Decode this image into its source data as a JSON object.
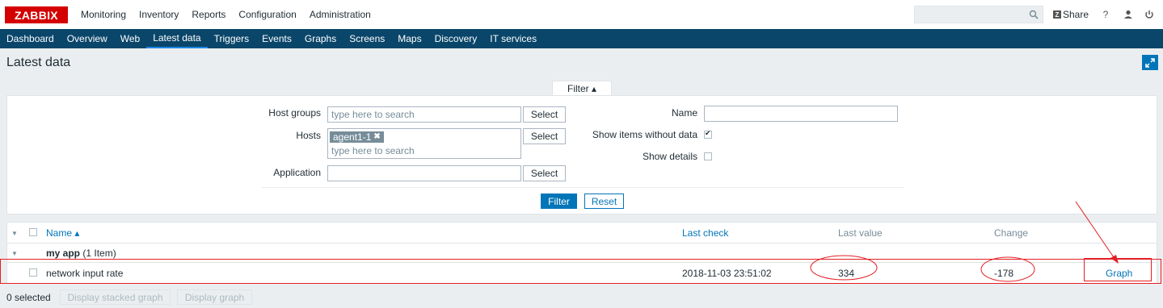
{
  "brand": {
    "logo": "ZABBIX"
  },
  "topmenu": [
    "Monitoring",
    "Inventory",
    "Reports",
    "Configuration",
    "Administration"
  ],
  "header_right": {
    "share": "Share",
    "help": "?",
    "search_placeholder": ""
  },
  "submenu": [
    "Dashboard",
    "Overview",
    "Web",
    "Latest data",
    "Triggers",
    "Events",
    "Graphs",
    "Screens",
    "Maps",
    "Discovery",
    "IT services"
  ],
  "page": {
    "title": "Latest data"
  },
  "filter": {
    "tab_label": "Filter ▴",
    "host_groups_label": "Host groups",
    "hosts_label": "Hosts",
    "application_label": "Application",
    "name_label": "Name",
    "show_without_data_label": "Show items without data",
    "show_details_label": "Show details",
    "search_placeholder": "type here to search",
    "select_label": "Select",
    "host_tag": "agent1-1",
    "filter_button": "Filter",
    "reset_button": "Reset",
    "show_without_data": true,
    "show_details": false
  },
  "table": {
    "columns": {
      "name": "Name ▴",
      "last_check": "Last check",
      "last_value": "Last value",
      "change": "Change"
    },
    "group": {
      "name": "my app",
      "count": "(1 Item)"
    },
    "rows": [
      {
        "name": "network input rate",
        "last_check": "2018-11-03 23:51:02",
        "last_value": "334",
        "change": "-178",
        "action": "Graph"
      }
    ]
  },
  "footer": {
    "selected": "0 selected",
    "stacked_graph": "Display stacked graph",
    "graph": "Display graph"
  },
  "colors": {
    "nav": "#0a466a",
    "accent": "#0275b8",
    "annotation": "#e31e24",
    "brand": "#d40000"
  }
}
